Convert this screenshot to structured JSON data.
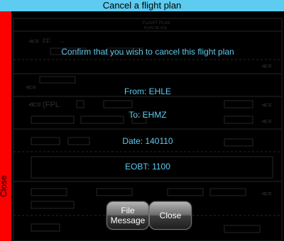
{
  "window": {
    "title": "Cancel a flight plan",
    "sidebar_label": "Close"
  },
  "dialog": {
    "confirm_text": "Confirm that you wish to cancel this flight plan",
    "from": "From: EHLE",
    "to": "To: EHMZ",
    "date": "Date: 140110",
    "eobt": "EOBT: 1100"
  },
  "buttons": {
    "file_message": "File\nMessage",
    "close": "Close"
  },
  "background_form": {
    "header": "FLIGHT PLAN",
    "subheader": "PLAN DE VOL",
    "priority": "FF",
    "message_type": "(FPL"
  },
  "colors": {
    "accent": "#5ecbf0",
    "sidebar": "#ff0000"
  }
}
